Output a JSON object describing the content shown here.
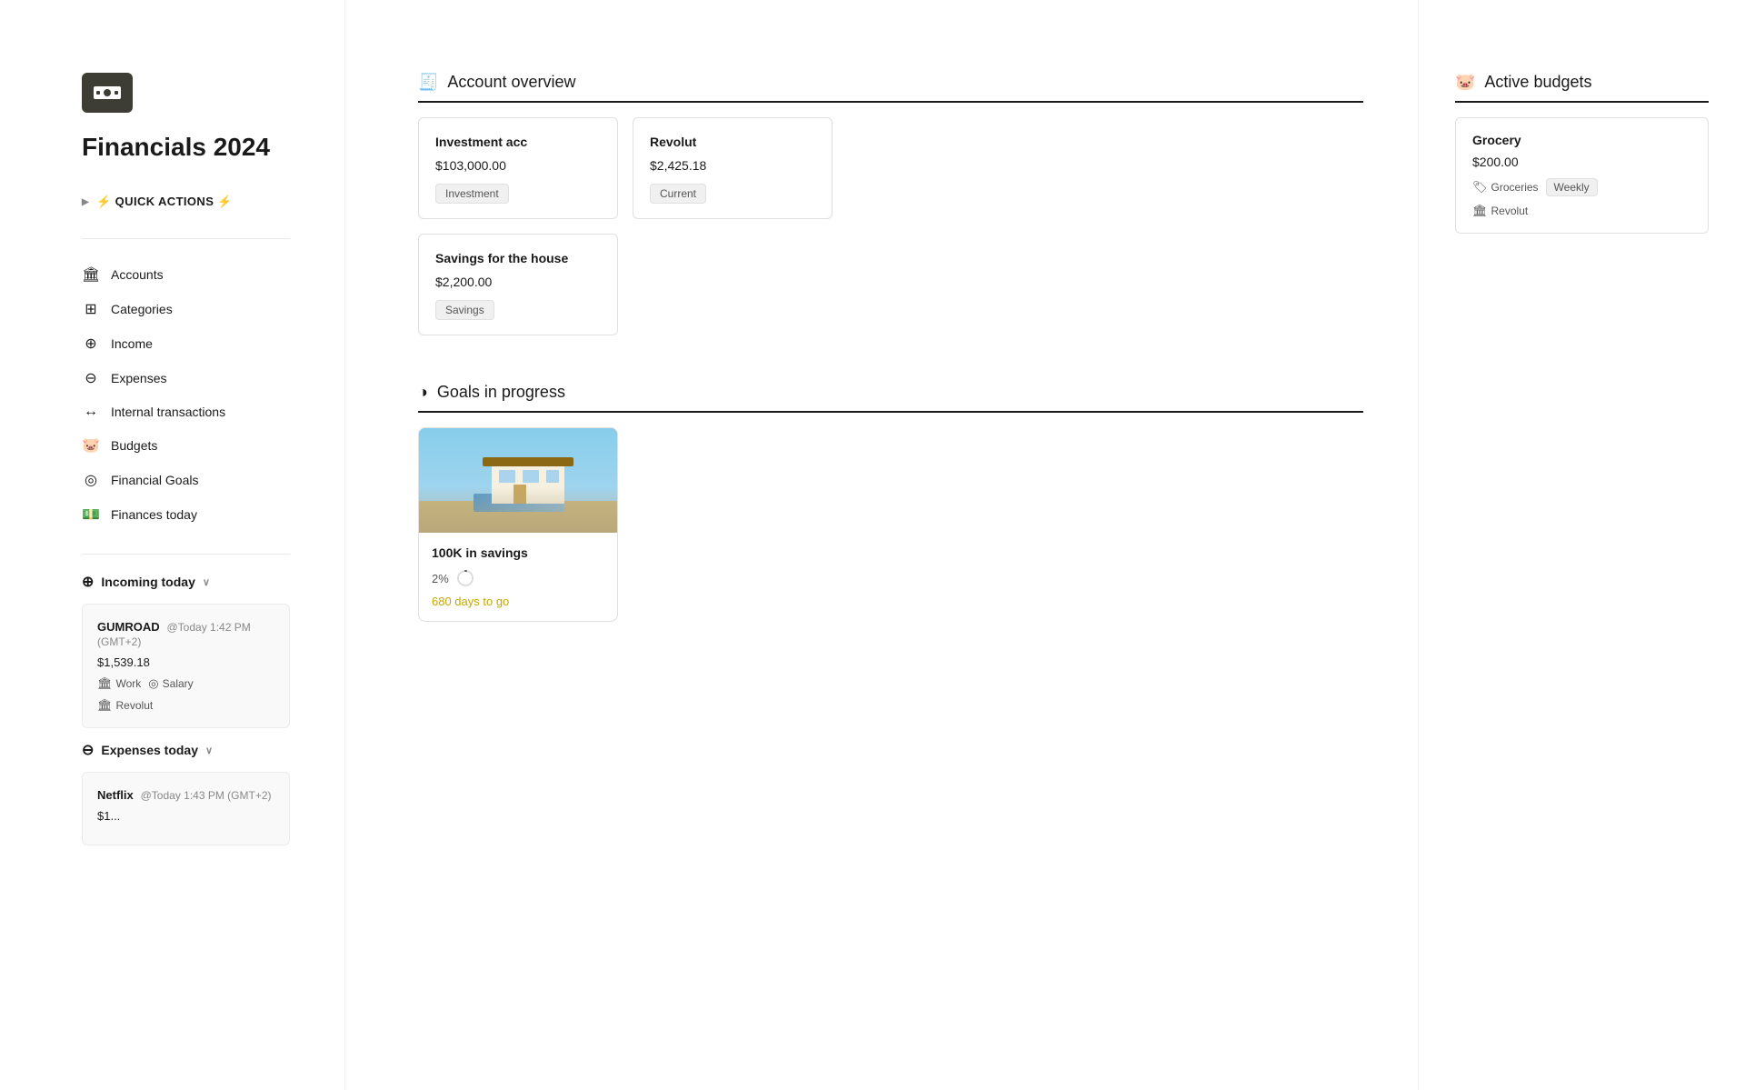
{
  "app": {
    "title": "Financials 2024",
    "logo_label": "money-icon"
  },
  "quick_actions": {
    "label": "⚡ QUICK ACTIONS ⚡"
  },
  "nav": {
    "items": [
      {
        "id": "accounts",
        "label": "Accounts",
        "icon": "🏛"
      },
      {
        "id": "categories",
        "label": "Categories",
        "icon": "⊞"
      },
      {
        "id": "income",
        "label": "Income",
        "icon": "⊕"
      },
      {
        "id": "expenses",
        "label": "Expenses",
        "icon": "⊖"
      },
      {
        "id": "internal-transactions",
        "label": "Internal transactions",
        "icon": "↔"
      },
      {
        "id": "budgets",
        "label": "Budgets",
        "icon": "🐷"
      },
      {
        "id": "financial-goals",
        "label": "Financial Goals",
        "icon": "◎"
      },
      {
        "id": "finances-today",
        "label": "Finances today",
        "icon": "💵"
      }
    ]
  },
  "incoming_today": {
    "label": "Incoming today",
    "items": [
      {
        "name": "GUMROAD",
        "date": "@Today 1:42 PM (GMT+2)",
        "amount": "$1,539.18",
        "tags": [
          "Work",
          "Salary"
        ],
        "account": "Revolut"
      }
    ]
  },
  "expenses_today": {
    "label": "Expenses today",
    "items": [
      {
        "name": "Netflix",
        "date": "@Today 1:43 PM (GMT+2)",
        "amount": "$1..."
      }
    ]
  },
  "account_overview": {
    "section_icon": "🧾",
    "title": "Account overview",
    "accounts": [
      {
        "name": "Investment acc",
        "amount": "$103,000.00",
        "type": "Investment"
      },
      {
        "name": "Revolut",
        "amount": "$2,425.18",
        "type": "Current"
      },
      {
        "name": "Savings for the house",
        "amount": "$2,200.00",
        "type": "Savings"
      }
    ]
  },
  "goals": {
    "section_icon": "◑",
    "title": "Goals in progress",
    "items": [
      {
        "name": "100K in savings",
        "percent": "2%",
        "days_label": "680 days to go"
      }
    ]
  },
  "active_budgets": {
    "section_icon": "🐷",
    "title": "Active budgets",
    "items": [
      {
        "name": "Grocery",
        "amount": "$200.00",
        "category": "Groceries",
        "frequency": "Weekly",
        "account": "Revolut"
      }
    ]
  }
}
